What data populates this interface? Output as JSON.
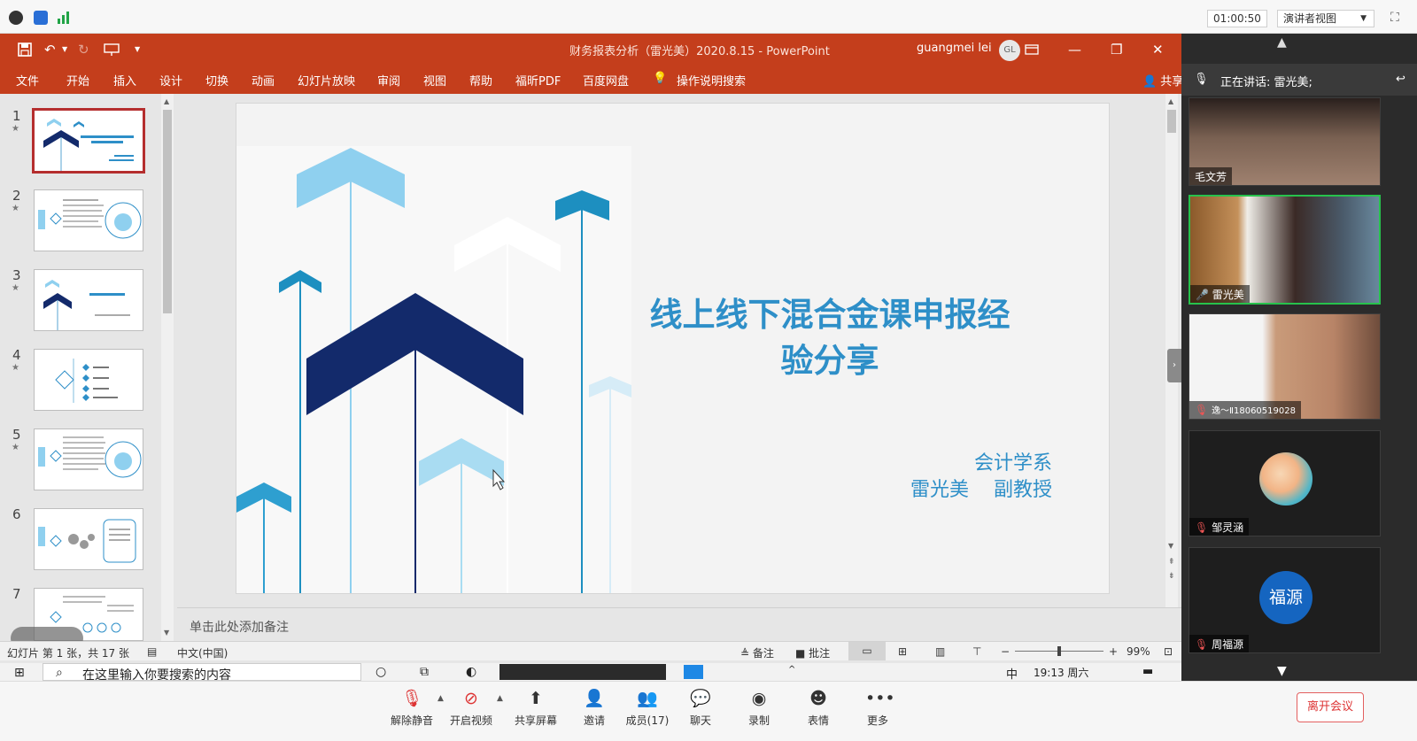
{
  "meeting": {
    "timer": "01:00:50",
    "view_mode": "演讲者视图",
    "speaking_label": "正在讲话: 雷光美;",
    "participants": [
      {
        "name": "毛文芳"
      },
      {
        "name": "雷光美"
      },
      {
        "name": "逸～Ⅱ18060519028"
      },
      {
        "name": "邹灵涵"
      },
      {
        "name": "周福源",
        "avatar_text": "福源"
      }
    ],
    "toolbar": {
      "mute": "解除静音",
      "video": "开启视频",
      "share": "共享屏幕",
      "invite": "邀请",
      "members": "成员(17)",
      "chat": "聊天",
      "record": "录制",
      "emoji": "表情",
      "more": "更多",
      "leave": "离开会议"
    }
  },
  "powerpoint": {
    "title": "财务报表分析（雷光美）2020.8.15  -  PowerPoint",
    "user": "guangmei lei",
    "user_initials": "GL",
    "tabs": [
      "文件",
      "开始",
      "插入",
      "设计",
      "切换",
      "动画",
      "幻灯片放映",
      "审阅",
      "视图",
      "帮助",
      "福昕PDF",
      "百度网盘",
      "操作说明搜索"
    ],
    "share": "共享",
    "thumbnail_numbers": [
      "1",
      "2",
      "3",
      "4",
      "5",
      "6",
      "7"
    ],
    "slide": {
      "title_line1": "线上线下混合金课申报经",
      "title_line2": "验分享",
      "dept": "会计学系",
      "author": "雷光美    副教授"
    },
    "notes_placeholder": "单击此处添加备注",
    "status": {
      "slide_info": "幻灯片 第 1 张，共 17 张",
      "language": "中文(中国)",
      "notes": "备注",
      "comments": "批注",
      "zoom": "99%"
    }
  },
  "taskbar": {
    "search_placeholder": "在这里输入你要搜索的内容",
    "clock": "19:13 周六",
    "ime": "中"
  },
  "colors": {
    "ppt_red": "#c43e1c",
    "accent_blue": "#2e8fc8",
    "navy": "#132a6b",
    "sky": "#8fd0ef",
    "active_green": "#27c24c"
  }
}
